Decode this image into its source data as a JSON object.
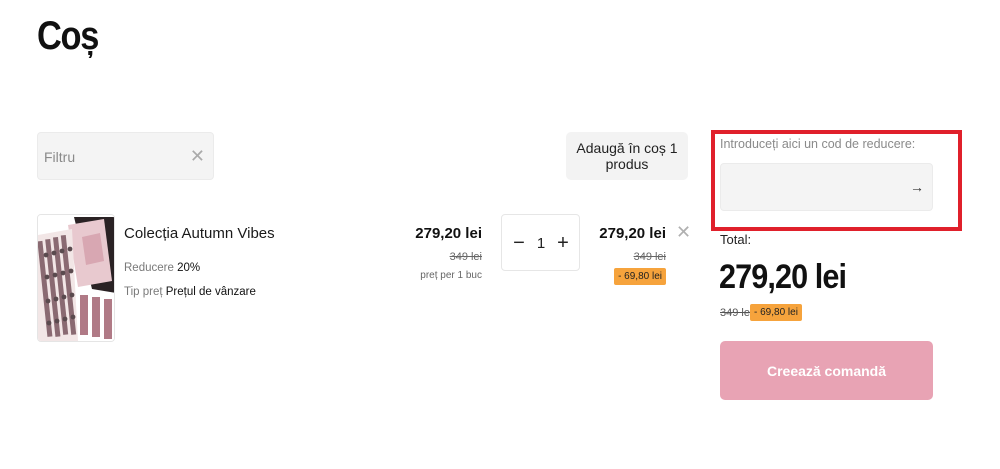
{
  "page": {
    "title": "Coș"
  },
  "filter": {
    "placeholder": "Filtru",
    "clear_icon": "close-icon"
  },
  "add_to_cart_label": "Adaugă în coș 1 produs",
  "cart_item": {
    "name": "Colecția Autumn Vibes",
    "discount_label": "Reducere",
    "discount_value": "20%",
    "price_type_label": "Tip preț",
    "price_type_value": "Prețul de vânzare",
    "unit_price": "279,20 lei",
    "unit_old_price": "349 lei",
    "unit_note": "preț per 1 buc",
    "quantity": "1",
    "line_total": "279,20 lei",
    "line_old_price": "349 lei",
    "line_discount": "- 69,80 lei",
    "image_icon": "eyeshadow-palette-image",
    "remove_icon": "close-icon"
  },
  "promo": {
    "label": "Introduceți aici un cod de reducere:",
    "placeholder": "",
    "submit_icon": "arrow-right-icon"
  },
  "summary": {
    "total_label": "Total:",
    "total_value": "279,20 lei",
    "old_total": "349 lei",
    "discount": "- 69,80 lei",
    "checkout_label": "Creează comandă"
  },
  "colors": {
    "discount_badge": "#f6a33c",
    "checkout_button": "#e8a3b4",
    "highlight_frame": "#e0202b"
  }
}
